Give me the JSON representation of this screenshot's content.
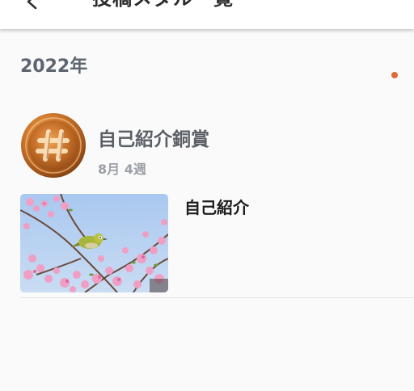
{
  "appbar": {
    "title": "投稿メダル一覧",
    "back_icon": "chevron-left-icon"
  },
  "year_section": {
    "year": "2022年"
  },
  "medal": {
    "icon": "hash-medal-icon",
    "tier_color": "#b86a2a",
    "title": "自己紹介銅賞",
    "week": "8月 4週"
  },
  "posts": [
    {
      "title": "自己紹介",
      "thumbnail": "bird-on-cherry-blossom-photo"
    }
  ],
  "colors": {
    "background": "#fafafa",
    "bronze": "#b86a2a",
    "accent": "#e0673a"
  }
}
